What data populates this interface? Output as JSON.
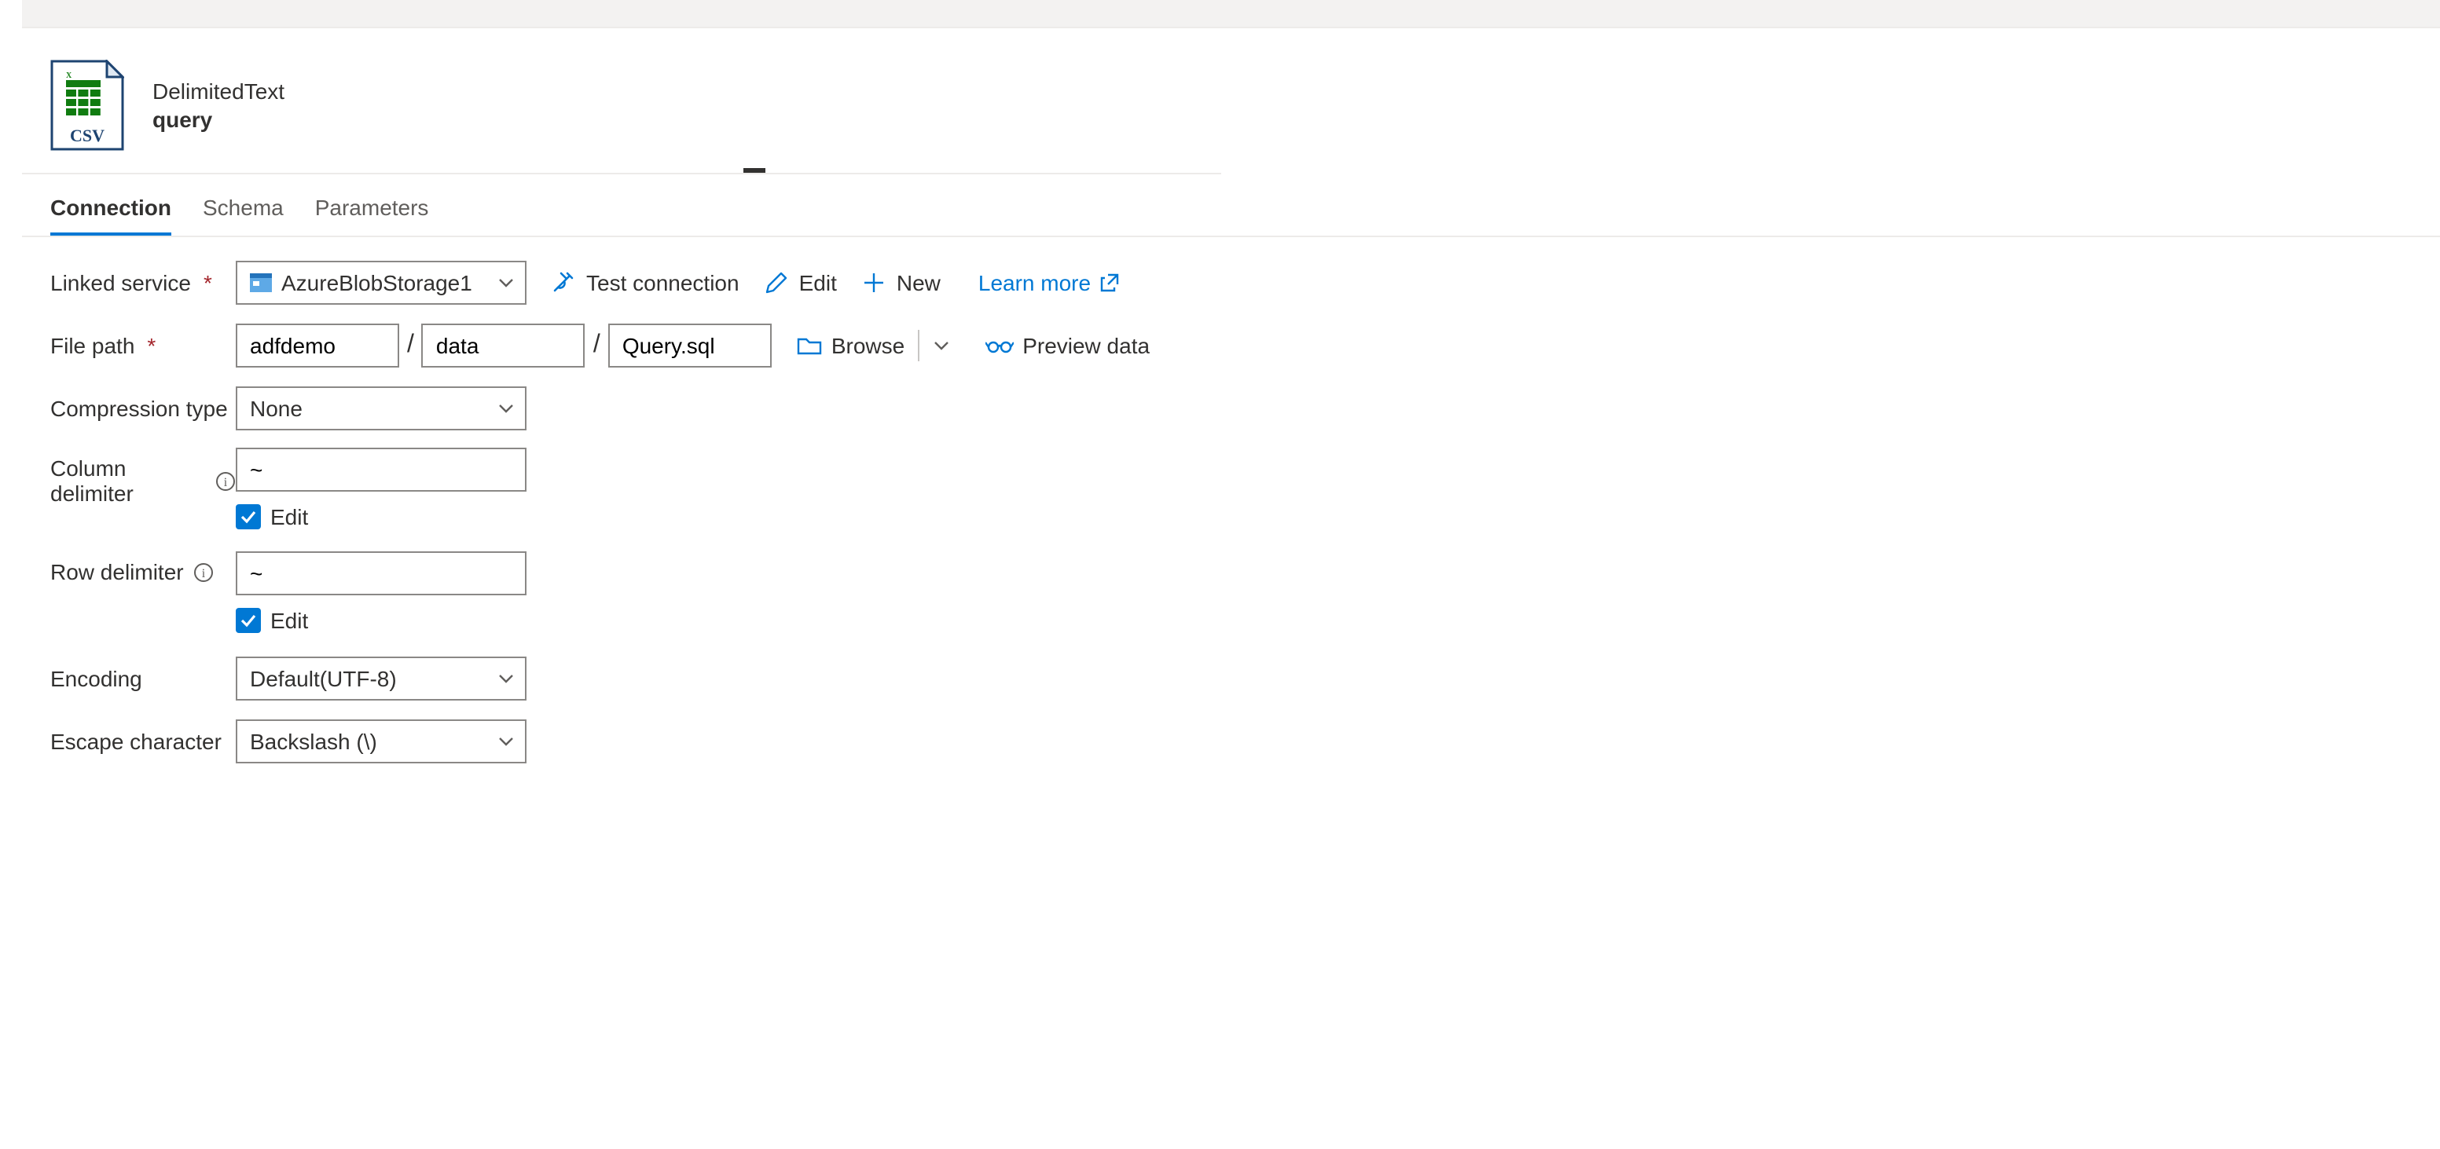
{
  "header": {
    "type": "DelimitedText",
    "name": "query",
    "icon_label": "CSV"
  },
  "tabs": {
    "connection": "Connection",
    "schema": "Schema",
    "parameters": "Parameters"
  },
  "labels": {
    "linked_service": "Linked service",
    "file_path": "File path",
    "compression_type": "Compression type",
    "column_delimiter": "Column delimiter",
    "row_delimiter": "Row delimiter",
    "encoding": "Encoding",
    "escape_character": "Escape character"
  },
  "values": {
    "linked_service": "AzureBlobStorage1",
    "file_path_container": "adfdemo",
    "file_path_folder": "data",
    "file_path_file": "Query.sql",
    "compression_type": "None",
    "column_delimiter": "~",
    "column_delimiter_edit_label": "Edit",
    "row_delimiter": "~",
    "row_delimiter_edit_label": "Edit",
    "encoding": "Default(UTF-8)",
    "escape_character": "Backslash (\\)"
  },
  "actions": {
    "test_connection": "Test connection",
    "edit": "Edit",
    "new": "New",
    "learn_more": "Learn more",
    "browse": "Browse",
    "preview_data": "Preview data"
  }
}
